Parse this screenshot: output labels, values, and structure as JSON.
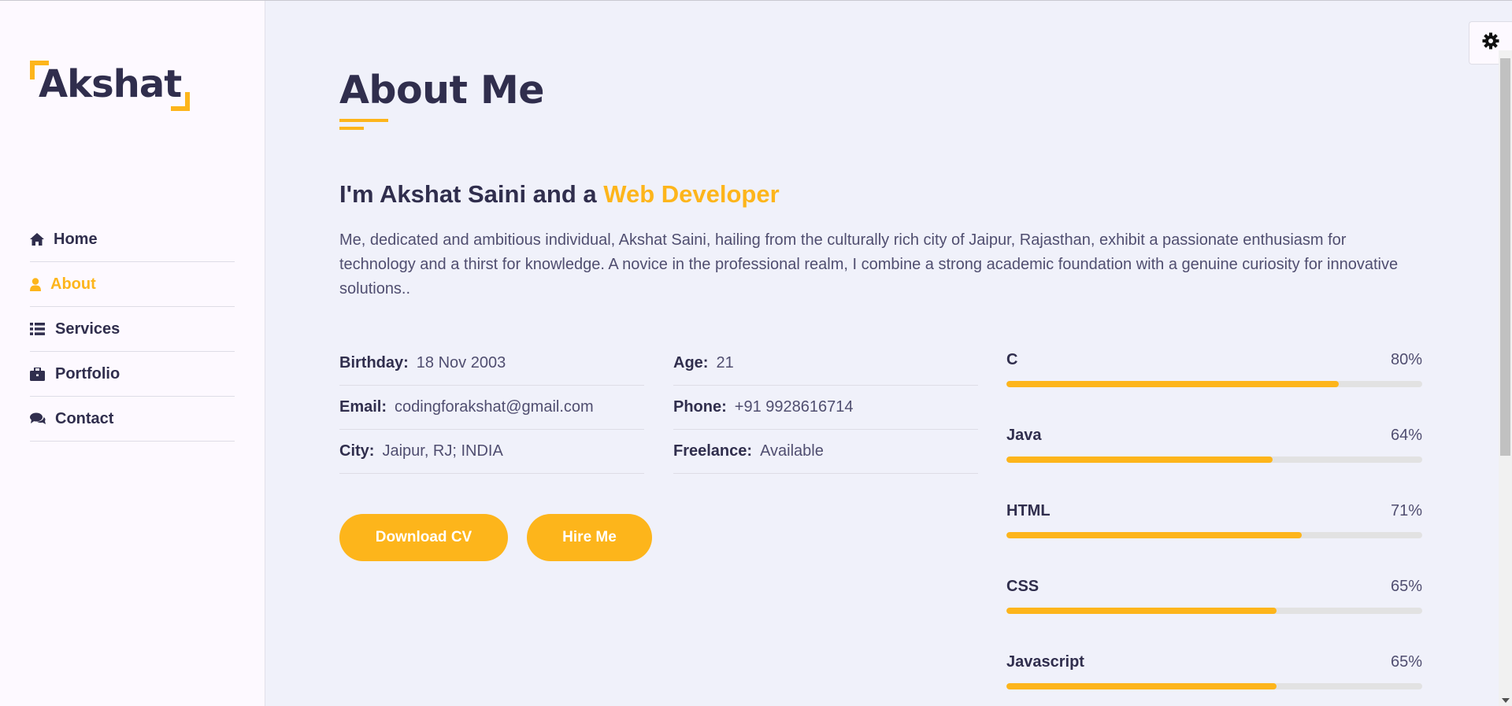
{
  "logo": {
    "text": "Akshat"
  },
  "nav": {
    "items": [
      {
        "label": "Home",
        "icon": "home-icon",
        "active": false
      },
      {
        "label": "About",
        "icon": "user-icon",
        "active": true
      },
      {
        "label": "Services",
        "icon": "list-icon",
        "active": false
      },
      {
        "label": "Portfolio",
        "icon": "briefcase-icon",
        "active": false
      },
      {
        "label": "Contact",
        "icon": "comments-icon",
        "active": false
      }
    ]
  },
  "main": {
    "title": "About Me",
    "intro_prefix": "I'm Akshat Saini and a ",
    "intro_accent": "Web Developer",
    "description": "Me, dedicated and ambitious individual, Akshat Saini, hailing from the culturally rich city of Jaipur, Rajasthan, exhibit a passionate enthusiasm for technology and a thirst for knowledge. A novice in the professional realm, I combine a strong academic foundation with a genuine curiosity for innovative solutions..",
    "info_left": [
      {
        "label": "Birthday:",
        "value": "18 Nov 2003"
      },
      {
        "label": "Email:",
        "value": "codingforakshat@gmail.com"
      },
      {
        "label": "City:",
        "value": "Jaipur, RJ; INDIA"
      }
    ],
    "info_right": [
      {
        "label": "Age:",
        "value": "21"
      },
      {
        "label": "Phone:",
        "value": "+91 9928616714"
      },
      {
        "label": "Freelance:",
        "value": "Available"
      }
    ],
    "buttons": {
      "download": "Download CV",
      "hire": "Hire Me"
    },
    "skills": [
      {
        "name": "C",
        "percent_label": "80%",
        "level": 0.8
      },
      {
        "name": "Java",
        "percent_label": "64%",
        "level": 0.64
      },
      {
        "name": "HTML",
        "percent_label": "71%",
        "level": 0.71
      },
      {
        "name": "CSS",
        "percent_label": "65%",
        "level": 0.65
      },
      {
        "name": "Javascript",
        "percent_label": "65%",
        "level": 0.65
      }
    ]
  },
  "colors": {
    "accent": "#fdb51b",
    "text": "#302e4d",
    "muted": "#504e70",
    "background": "#f0f1fa",
    "sidebar": "#fdf9ff"
  },
  "switcher": {
    "icon": "gear-icon"
  }
}
